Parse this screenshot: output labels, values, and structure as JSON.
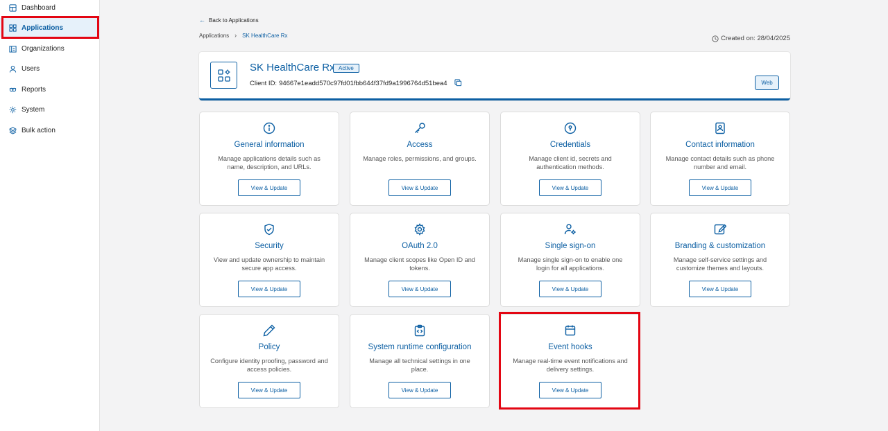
{
  "sidebar": {
    "items": [
      {
        "label": "Dashboard",
        "icon": "dashboard-icon"
      },
      {
        "label": "Applications",
        "icon": "applications-icon"
      },
      {
        "label": "Organizations",
        "icon": "organizations-icon"
      },
      {
        "label": "Users",
        "icon": "user-icon"
      },
      {
        "label": "Reports",
        "icon": "reports-icon"
      },
      {
        "label": "System",
        "icon": "gear-icon"
      },
      {
        "label": "Bulk action",
        "icon": "layers-icon"
      }
    ],
    "active": "Applications"
  },
  "header": {
    "back_label": "Back to Applications",
    "breadcrumb": [
      "Applications",
      "SK HealthCare Rx"
    ],
    "created_label": "Created on: 28/04/2025"
  },
  "app": {
    "name": "SK HealthCare Rx",
    "status": "Active",
    "client_id_label": "Client ID:",
    "client_id": "94667e1eadd570c97fd01fbb644f37fd9a1996764d51bea4",
    "type_badge": "Web"
  },
  "tiles": [
    {
      "title": "General information",
      "desc": "Manage applications details such as name, description, and URLs.",
      "button": "View & Update",
      "icon": "info-icon"
    },
    {
      "title": "Access",
      "desc": "Manage roles, permissions, and groups.",
      "button": "View & Update",
      "icon": "key-icon"
    },
    {
      "title": "Credentials",
      "desc": "Manage client id, secrets and authentication methods.",
      "button": "View & Update",
      "icon": "keyhole-icon"
    },
    {
      "title": "Contact information",
      "desc": "Manage contact details such as phone number and email.",
      "button": "View & Update",
      "icon": "contact-card-icon"
    },
    {
      "title": "Security",
      "desc": "View and update ownership to maintain secure app access.",
      "button": "View & Update",
      "icon": "shield-check-icon"
    },
    {
      "title": "OAuth 2.0",
      "desc": "Manage client scopes like Open ID and tokens.",
      "button": "View & Update",
      "icon": "gear-icon"
    },
    {
      "title": "Single sign-on",
      "desc": "Manage single sign-on to enable one login for all applications.",
      "button": "View & Update",
      "icon": "user-gear-icon"
    },
    {
      "title": "Branding & customization",
      "desc": "Manage self-service settings and customize themes and layouts.",
      "button": "View & Update",
      "icon": "edit-square-icon"
    },
    {
      "title": "Policy",
      "desc": "Configure identity proofing, password and access policies.",
      "button": "View & Update",
      "icon": "pencil-icon"
    },
    {
      "title": "System runtime configuration",
      "desc": "Manage all technical settings in one place.",
      "button": "View & Update",
      "icon": "code-clipboard-icon"
    },
    {
      "title": "Event hooks",
      "desc": "Manage real-time event notifications and delivery settings.",
      "button": "View & Update",
      "icon": "calendar-icon"
    }
  ],
  "colors": {
    "accent": "#0c5fa3",
    "highlight": "#e30613",
    "background": "#f3f3f4"
  }
}
